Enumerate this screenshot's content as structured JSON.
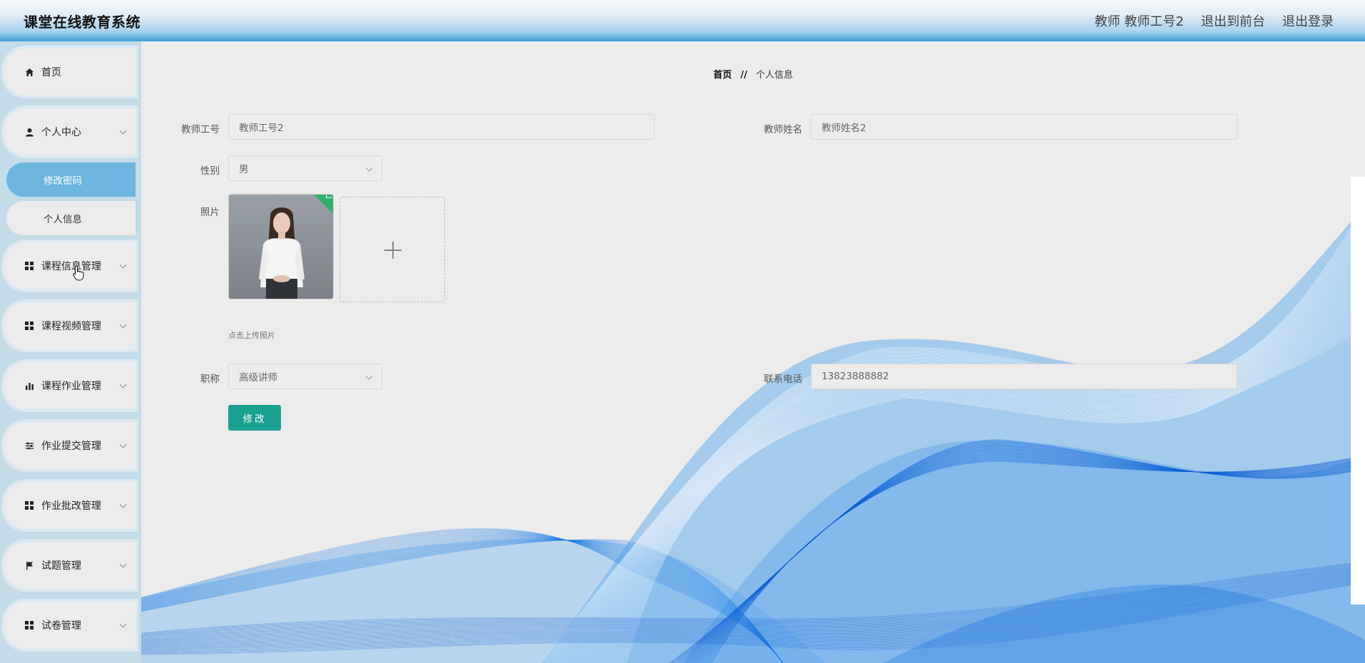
{
  "header": {
    "app_title": "课堂在线教育系统",
    "user_label": "教师 教师工号2",
    "back_to_front": "退出到前台",
    "logout": "退出登录"
  },
  "sidebar": {
    "items": [
      {
        "label": "首页",
        "icon": "home-icon"
      },
      {
        "label": "个人中心",
        "icon": "user-icon",
        "expanded": true,
        "children": [
          {
            "label": "修改密码",
            "active": true
          },
          {
            "label": "个人信息",
            "active": false
          }
        ]
      },
      {
        "label": "课程信息管理",
        "icon": "grid-icon"
      },
      {
        "label": "课程视频管理",
        "icon": "grid-icon"
      },
      {
        "label": "课程作业管理",
        "icon": "bar-chart-icon"
      },
      {
        "label": "作业提交管理",
        "icon": "sliders-icon"
      },
      {
        "label": "作业批改管理",
        "icon": "grid-icon"
      },
      {
        "label": "试题管理",
        "icon": "flag-icon"
      },
      {
        "label": "试卷管理",
        "icon": "grid-icon"
      }
    ]
  },
  "breadcrumb": {
    "home": "首页",
    "separator": "//",
    "current": "个人信息"
  },
  "form": {
    "teacher_id_label": "教师工号",
    "teacher_id_placeholder": "教师工号2",
    "teacher_name_label": "教师姓名",
    "teacher_name_placeholder": "教师姓名2",
    "gender_label": "性别",
    "gender_value": "男",
    "photo_label": "照片",
    "upload_hint": "点击上传照片",
    "title_label": "职称",
    "title_value": "高级讲师",
    "phone_label": "联系电话",
    "phone_value": "13823888882",
    "submit_label": "修改"
  },
  "colors": {
    "accent_teal": "#1aa091",
    "active_menu": "#6cb6df",
    "header_blue": "#3e9ed8",
    "wave_blue": "#1f7fe6"
  }
}
